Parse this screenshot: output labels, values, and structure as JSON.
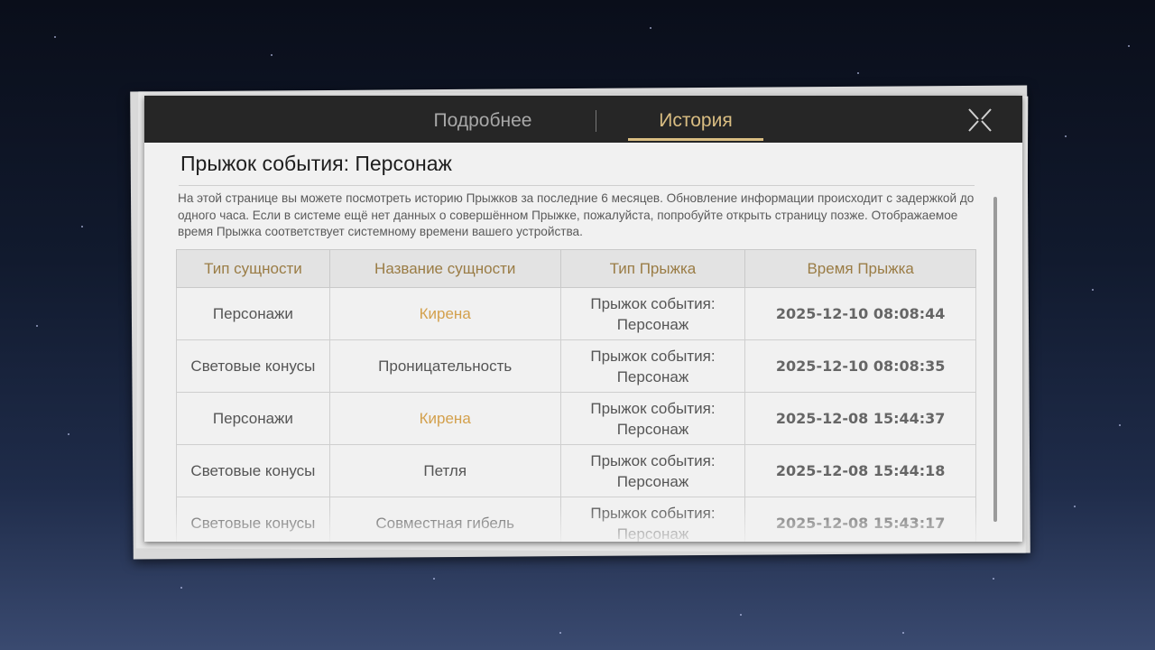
{
  "tabs": {
    "details": "Подробнее",
    "history": "История"
  },
  "title": "Прыжок события: Персонаж",
  "description": "На этой странице вы можете посмотреть историю Прыжков за последние 6 месяцев. Обновление информации происходит с задержкой до одного часа. Если в системе ещё нет данных о совершённом Прыжке, пожалуйста, попробуйте открыть страницу позже. Отображаемое время Прыжка соответствует системному времени вашего устройства.",
  "columns": [
    "Тип сущности",
    "Название сущности",
    "Тип Прыжка",
    "Время Прыжка"
  ],
  "rows": [
    {
      "type": "Персонажи",
      "name": "Кирена",
      "highlight": true,
      "jump": "Прыжок события: Персонаж",
      "time": "2025-12-10 08:08:44"
    },
    {
      "type": "Световые конусы",
      "name": "Проницательность",
      "highlight": false,
      "jump": "Прыжок события: Персонаж",
      "time": "2025-12-10 08:08:35"
    },
    {
      "type": "Персонажи",
      "name": "Кирена",
      "highlight": true,
      "jump": "Прыжок события: Персонаж",
      "time": "2025-12-08 15:44:37"
    },
    {
      "type": "Световые конусы",
      "name": "Петля",
      "highlight": false,
      "jump": "Прыжок события: Персонаж",
      "time": "2025-12-08 15:44:18"
    },
    {
      "type": "Световые конусы",
      "name": "Совместная гибель",
      "highlight": false,
      "jump": "Прыжок события: Персонаж",
      "time": "2025-12-08 15:43:17"
    }
  ],
  "colors": {
    "accent": "#d9bd82",
    "highlight": "#d3a04c",
    "header_bg": "#262626"
  }
}
